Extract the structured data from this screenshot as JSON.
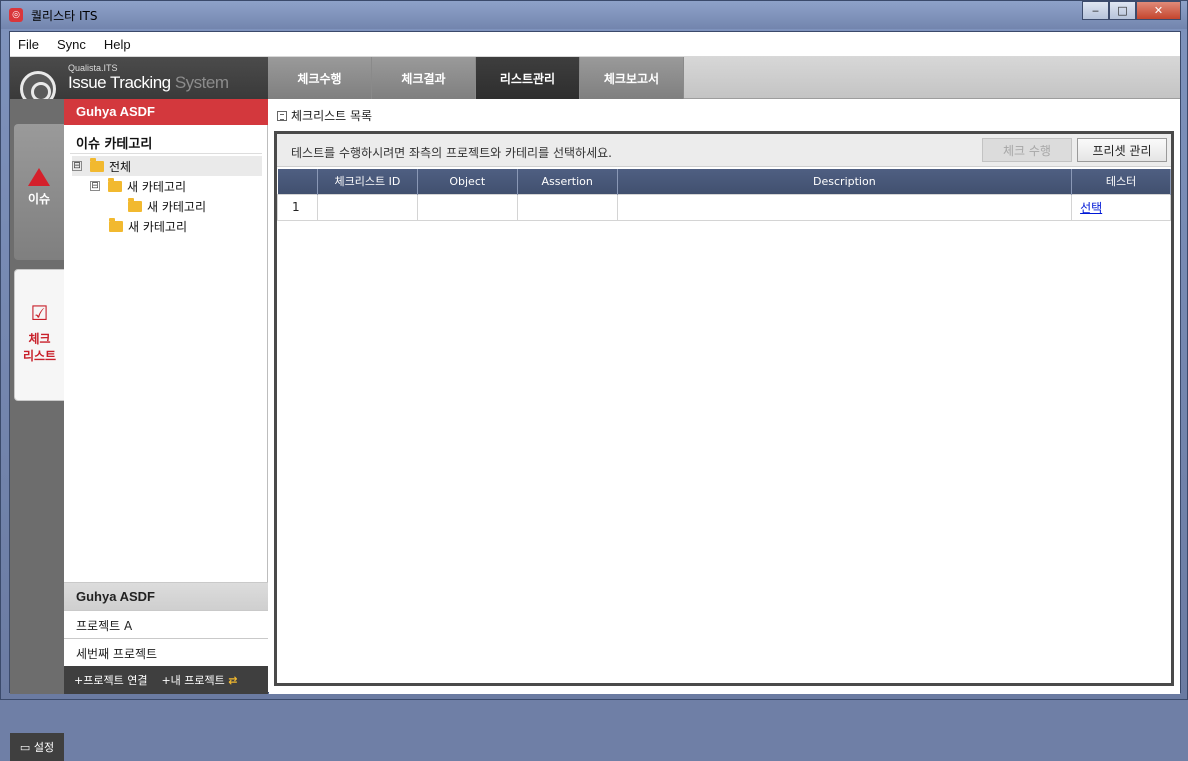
{
  "window": {
    "title": "퀄리스타 ITS",
    "buttons": {
      "minimize": "‒",
      "maximize": "□",
      "close": "✕"
    }
  },
  "menu": [
    "File",
    "Sync",
    "Help"
  ],
  "brand": {
    "small": "Qualista.ITS",
    "main": "Issue Tracking",
    "sys": "System"
  },
  "tabs": [
    "체크수행",
    "체크결과",
    "리스트관리",
    "체크보고서"
  ],
  "active_tab": "리스트관리",
  "side_tabs": {
    "issue": "이슈",
    "checklist_line1": "체크",
    "checklist_line2": "리스트",
    "settings": "설정"
  },
  "sidebar": {
    "project": "Guhya ASDF",
    "category_title": "이슈 카테고리",
    "tree": [
      {
        "label": "전체",
        "expander": "⊟",
        "level": 0
      },
      {
        "label": "새 카테고리",
        "expander": "⊟",
        "level": 1
      },
      {
        "label": "새 카테고리",
        "expander": "",
        "level": 2
      },
      {
        "label": "새 카테고리",
        "expander": "",
        "level": 1
      }
    ],
    "projects": [
      "Guhya ASDF",
      "프로젝트 A",
      "세번째 프로젝트"
    ],
    "footer": {
      "connect": "+프로젝트 연결",
      "my": "+내 프로젝트"
    }
  },
  "main": {
    "title": "체크리스트 목록",
    "notice": "테스트를 수행하시려면 좌측의 프로젝트와 카테리를 선택하세요.",
    "run_button": "체크 수행",
    "preset_button": "프리셋 관리",
    "columns": [
      "",
      "체크리스트 ID",
      "Object",
      "Assertion",
      "Description",
      "테스터"
    ],
    "rows": [
      {
        "num": "1",
        "id": "",
        "object": "",
        "assertion": "",
        "description": "",
        "tester": "선택"
      }
    ]
  }
}
